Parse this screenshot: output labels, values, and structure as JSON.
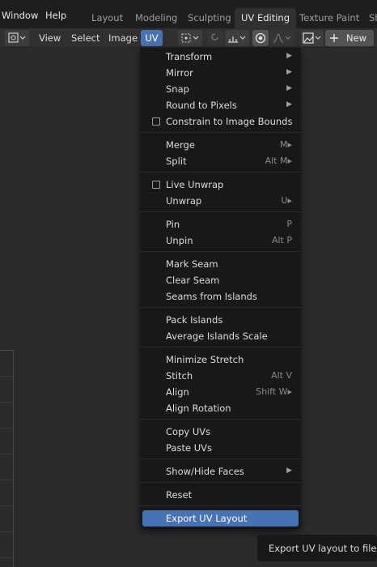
{
  "topbar": {
    "menus": [
      "Window",
      "Help"
    ],
    "workspaces": [
      "Layout",
      "Modeling",
      "Sculpting",
      "UV Editing",
      "Texture Paint",
      "Sh"
    ],
    "active_workspace": "UV Editing"
  },
  "header": {
    "view": "View",
    "select": "Select",
    "image": "Image",
    "uv": "UV",
    "new_label": "New"
  },
  "menu": {
    "items": [
      {
        "label": "Transform",
        "shortcut": "",
        "submenu": true
      },
      {
        "label": "Mirror",
        "shortcut": "",
        "submenu": true
      },
      {
        "label": "Snap",
        "shortcut": "",
        "submenu": true
      },
      {
        "label": "Round to Pixels",
        "shortcut": "",
        "submenu": true
      },
      {
        "label": "Constrain to Image Bounds",
        "checkbox": true
      },
      {
        "label": "Merge",
        "shortcut": "M▸"
      },
      {
        "label": "Split",
        "shortcut": "Alt M▸"
      },
      {
        "label": "Live Unwrap",
        "checkbox": true
      },
      {
        "label": "Unwrap",
        "shortcut": "U▸"
      },
      {
        "label": "Pin",
        "shortcut": "P"
      },
      {
        "label": "Unpin",
        "shortcut": "Alt P"
      },
      {
        "label": "Mark Seam"
      },
      {
        "label": "Clear Seam"
      },
      {
        "label": "Seams from Islands"
      },
      {
        "label": "Pack Islands"
      },
      {
        "label": "Average Islands Scale"
      },
      {
        "label": "Minimize Stretch"
      },
      {
        "label": "Stitch",
        "shortcut": "Alt V"
      },
      {
        "label": "Align",
        "shortcut": "Shift W▸"
      },
      {
        "label": "Align Rotation"
      },
      {
        "label": "Copy UVs"
      },
      {
        "label": "Paste UVs"
      },
      {
        "label": "Show/Hide Faces",
        "submenu": true
      },
      {
        "label": "Reset"
      },
      {
        "label": "Export UV Layout",
        "highlighted": true
      }
    ]
  },
  "tooltip": {
    "text": "Export UV layout to file."
  },
  "colors": {
    "accent": "#4772b3",
    "menu_bg": "#181818",
    "header_bg": "#303030",
    "topbar_bg": "#1e1e1e"
  }
}
